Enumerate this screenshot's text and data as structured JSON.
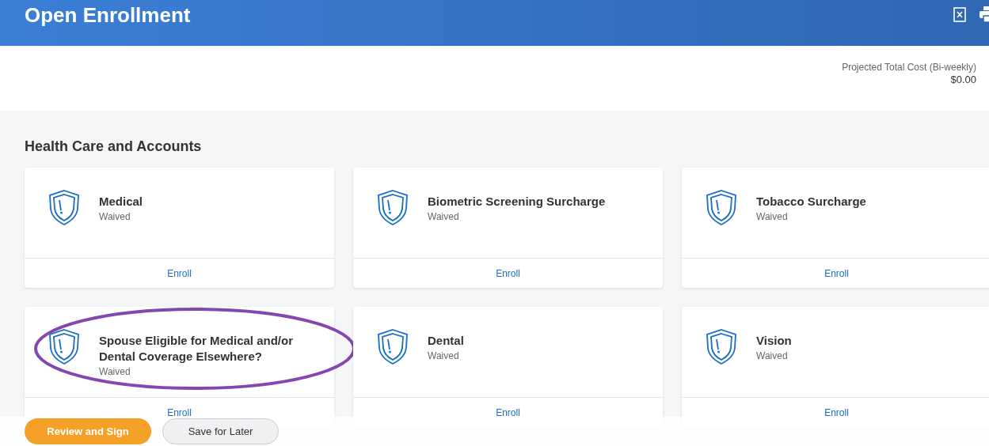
{
  "header": {
    "title": "Open Enrollment"
  },
  "summary": {
    "label": "Projected Total Cost (Bi-weekly)",
    "value": "$0.00"
  },
  "section": {
    "title": "Health Care and Accounts"
  },
  "cards": [
    {
      "title": "Medical",
      "status": "Waived",
      "action": "Enroll",
      "circled": false
    },
    {
      "title": "Biometric Screening Surcharge",
      "status": "Waived",
      "action": "Enroll",
      "circled": false
    },
    {
      "title": "Tobacco Surcharge",
      "status": "Waived",
      "action": "Enroll",
      "circled": false
    },
    {
      "title": "Spouse Eligible for Medical and/or Dental Coverage Elsewhere?",
      "status": "Waived",
      "action": "Enroll",
      "circled": true
    },
    {
      "title": "Dental",
      "status": "Waived",
      "action": "Enroll",
      "circled": false
    },
    {
      "title": "Vision",
      "status": "Waived",
      "action": "Enroll",
      "circled": false
    }
  ],
  "footer": {
    "buttons": [
      {
        "label": "Review and Sign",
        "kind": "primary"
      },
      {
        "label": "Save for Later",
        "kind": "secondary"
      }
    ]
  }
}
